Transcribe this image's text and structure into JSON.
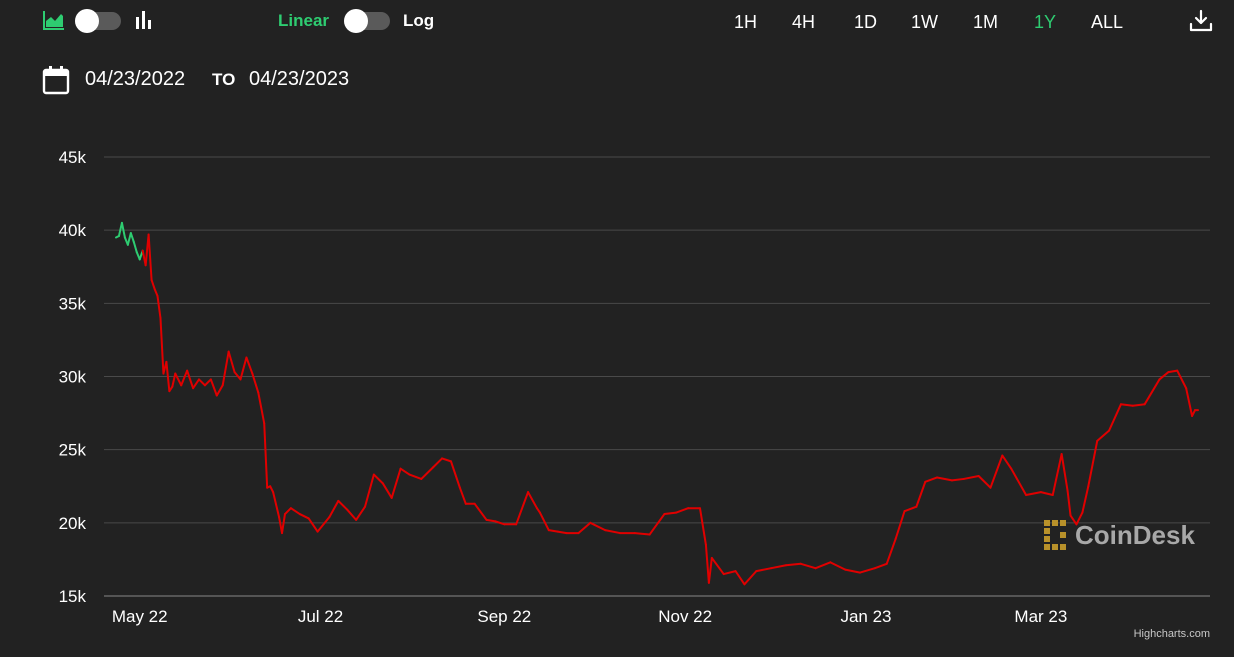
{
  "toolbar": {
    "area_chart_icon": "area-chart-icon",
    "bar_chart_icon": "bar-chart-icon",
    "scale": {
      "linear_label": "Linear",
      "log_label": "Log",
      "selected": "Linear"
    },
    "ranges": [
      "1H",
      "4H",
      "1D",
      "1W",
      "1M",
      "1Y",
      "ALL"
    ],
    "selected_range": "1Y",
    "download_icon": "download-icon"
  },
  "date_range": {
    "calendar_icon": "calendar-icon",
    "start": "04/23/2022",
    "to_label": "TO",
    "end": "04/23/2023"
  },
  "colors": {
    "background": "#222222",
    "accent": "#2ecc71",
    "up": "#2ecc71",
    "down": "#e00000",
    "grid": "#4a4a4a",
    "text": "#ffffff"
  },
  "chart_data": {
    "type": "line",
    "y_ticks": [
      "15k",
      "20k",
      "25k",
      "30k",
      "35k",
      "40k",
      "45k"
    ],
    "ylim": [
      15000,
      45000
    ],
    "x_ticks": [
      "May 22",
      "Jul 22",
      "Sep 22",
      "Nov 22",
      "Jan 23",
      "Mar 23"
    ],
    "x_tick_dates": [
      "2022-05-01",
      "2022-07-01",
      "2022-09-01",
      "2022-11-01",
      "2023-01-01",
      "2023-03-01"
    ],
    "xlim": [
      "2022-04-23",
      "2023-04-23"
    ],
    "grid": true,
    "series": [
      {
        "x": [
          "2022-04-23",
          "2022-04-24",
          "2022-04-25",
          "2022-04-26",
          "2022-04-27",
          "2022-04-28",
          "2022-04-29",
          "2022-04-30",
          "2022-05-01",
          "2022-05-02",
          "2022-05-03",
          "2022-05-04",
          "2022-05-05",
          "2022-05-06",
          "2022-05-07",
          "2022-05-08",
          "2022-05-09",
          "2022-05-10",
          "2022-05-11",
          "2022-05-12",
          "2022-05-13",
          "2022-05-15",
          "2022-05-17",
          "2022-05-19",
          "2022-05-21",
          "2022-05-23",
          "2022-05-25",
          "2022-05-27",
          "2022-05-29",
          "2022-05-31",
          "2022-06-02",
          "2022-06-04",
          "2022-06-06",
          "2022-06-08",
          "2022-06-10",
          "2022-06-12",
          "2022-06-13",
          "2022-06-14",
          "2022-06-15",
          "2022-06-17",
          "2022-06-18",
          "2022-06-19",
          "2022-06-21",
          "2022-06-24",
          "2022-06-27",
          "2022-06-30",
          "2022-07-04",
          "2022-07-07",
          "2022-07-10",
          "2022-07-13",
          "2022-07-16",
          "2022-07-19",
          "2022-07-22",
          "2022-07-25",
          "2022-07-28",
          "2022-07-31",
          "2022-08-04",
          "2022-08-08",
          "2022-08-11",
          "2022-08-14",
          "2022-08-17",
          "2022-08-19",
          "2022-08-22",
          "2022-08-26",
          "2022-08-29",
          "2022-09-01",
          "2022-09-05",
          "2022-09-09",
          "2022-09-12",
          "2022-09-13",
          "2022-09-16",
          "2022-09-19",
          "2022-09-22",
          "2022-09-26",
          "2022-09-30",
          "2022-10-05",
          "2022-10-10",
          "2022-10-15",
          "2022-10-20",
          "2022-10-25",
          "2022-10-29",
          "2022-11-02",
          "2022-11-06",
          "2022-11-08",
          "2022-11-09",
          "2022-11-10",
          "2022-11-14",
          "2022-11-18",
          "2022-11-21",
          "2022-11-25",
          "2022-11-30",
          "2022-12-05",
          "2022-12-10",
          "2022-12-15",
          "2022-12-20",
          "2022-12-25",
          "2022-12-30",
          "2023-01-04",
          "2023-01-08",
          "2023-01-11",
          "2023-01-14",
          "2023-01-18",
          "2023-01-21",
          "2023-01-25",
          "2023-01-30",
          "2023-02-03",
          "2023-02-08",
          "2023-02-12",
          "2023-02-16",
          "2023-02-19",
          "2023-02-24",
          "2023-03-01",
          "2023-03-05",
          "2023-03-08",
          "2023-03-10",
          "2023-03-11",
          "2023-03-13",
          "2023-03-15",
          "2023-03-17",
          "2023-03-20",
          "2023-03-24",
          "2023-03-28",
          "2023-04-01",
          "2023-04-05",
          "2023-04-10",
          "2023-04-13",
          "2023-04-16",
          "2023-04-19",
          "2023-04-21",
          "2023-04-22",
          "2023-04-23"
        ],
        "values": [
          39500,
          39600,
          40500,
          39500,
          39000,
          39800,
          39200,
          38500,
          38000,
          38600,
          37600,
          39700,
          36600,
          36000,
          35500,
          34000,
          30200,
          31000,
          29000,
          29300,
          30200,
          29400,
          30400,
          29200,
          29800,
          29400,
          29800,
          28700,
          29400,
          31700,
          30300,
          29800,
          31300,
          30200,
          28900,
          26800,
          22400,
          22500,
          22100,
          20400,
          19300,
          20600,
          21000,
          20600,
          20300,
          19400,
          20400,
          21500,
          20900,
          20200,
          21100,
          23300,
          22700,
          21700,
          23700,
          23300,
          23000,
          23800,
          24400,
          24200,
          22400,
          21300,
          21300,
          20200,
          20100,
          19900,
          19900,
          22100,
          21000,
          20700,
          19500,
          19400,
          19300,
          19300,
          20000,
          19500,
          19300,
          19300,
          19200,
          20600,
          20700,
          21000,
          21000,
          18500,
          15900,
          17600,
          16500,
          16700,
          15800,
          16700,
          16900,
          17100,
          17200,
          16900,
          17300,
          16800,
          16600,
          16900,
          17200,
          18900,
          20800,
          21100,
          22800,
          23100,
          22900,
          23000,
          23200,
          22400,
          24600,
          23700,
          21900,
          22100,
          21900,
          24700,
          22200,
          20500,
          19900,
          20700,
          22500,
          25600,
          26300,
          28100,
          28000,
          28100,
          29800,
          30300,
          30400,
          29200,
          27300,
          27700,
          27700
        ],
        "up_segment_count": 9
      }
    ]
  },
  "watermark": {
    "logo_icon": "coindesk-logo-icon",
    "text": "CoinDesk"
  },
  "credits": "Highcharts.com"
}
